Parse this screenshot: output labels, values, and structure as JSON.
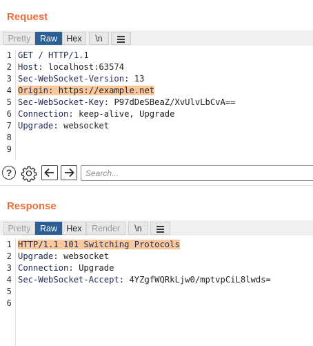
{
  "request": {
    "title": "Request",
    "tabs": [
      {
        "label": "Pretty",
        "state": "disabled"
      },
      {
        "label": "Raw",
        "state": "active"
      },
      {
        "label": "Hex",
        "state": "enabled"
      }
    ],
    "newline_label": "\\n",
    "gutter": [
      "1",
      "2",
      "3",
      "4",
      "5",
      "6",
      "7",
      "8",
      "9"
    ],
    "lines": [
      {
        "name": "GET / HTTP/1.1",
        "value": ""
      },
      {
        "name": "Host",
        "value": "localhost:63574"
      },
      {
        "name": "Sec-WebSocket-Version",
        "value": "13"
      },
      {
        "name": "Origin",
        "value": "https://example.net"
      },
      {
        "name": "Sec-WebSocket-Key",
        "value": "P97dDeSBeaZ/XvUlvLbCvA=="
      },
      {
        "name": "Connection",
        "value": "keep-alive, Upgrade"
      },
      {
        "name": "Upgrade",
        "value": "websocket"
      },
      {
        "name": "",
        "value": ""
      },
      {
        "name": "",
        "value": ""
      }
    ],
    "search_placeholder": "Search..."
  },
  "response": {
    "title": "Response",
    "tabs": [
      {
        "label": "Pretty",
        "state": "disabled"
      },
      {
        "label": "Raw",
        "state": "active"
      },
      {
        "label": "Hex",
        "state": "enabled"
      },
      {
        "label": "Render",
        "state": "disabled"
      }
    ],
    "newline_label": "\\n",
    "gutter": [
      "1",
      "2",
      "3",
      "4",
      "5",
      "6"
    ],
    "lines": [
      {
        "name": "HTTP/1.1 101 Switching Protocols",
        "value": ""
      },
      {
        "name": "Upgrade",
        "value": "websocket"
      },
      {
        "name": "Connection",
        "value": "Upgrade"
      },
      {
        "name": "Sec-WebSocket-Accept",
        "value": "4YZgfWQRkLjw0/mptvpCiL8lwds="
      },
      {
        "name": "",
        "value": ""
      },
      {
        "name": "",
        "value": ""
      }
    ]
  },
  "colors": {
    "title": "#ef6c3a",
    "active_tab": "#2c5f94",
    "highlight": "#f9c89d"
  },
  "icons": {
    "help": "help-icon",
    "settings": "gear-icon",
    "back": "arrow-left-icon",
    "forward": "arrow-right-icon",
    "menu": "hamburger-menu-icon"
  }
}
